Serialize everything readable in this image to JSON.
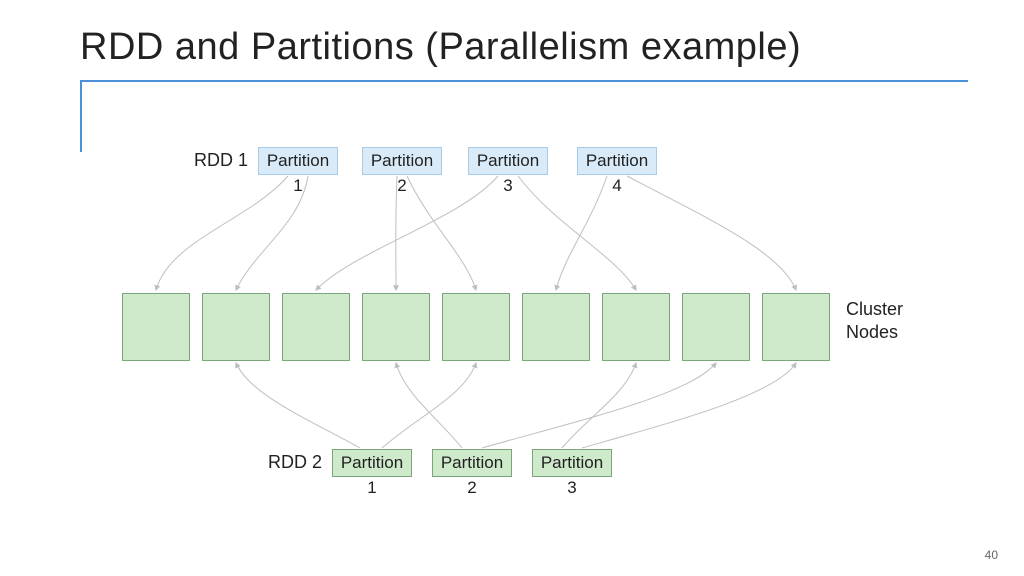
{
  "slide": {
    "title": "RDD and Partitions (Parallelism example)",
    "page_number": "40"
  },
  "rdd1": {
    "label": "RDD 1",
    "partitions": [
      {
        "name": "Partition",
        "num": "1"
      },
      {
        "name": "Partition",
        "num": "2"
      },
      {
        "name": "Partition",
        "num": "3"
      },
      {
        "name": "Partition",
        "num": "4"
      }
    ]
  },
  "cluster": {
    "label": "Cluster\nNodes",
    "count": 9
  },
  "rdd2": {
    "label": "RDD 2",
    "partitions": [
      {
        "name": "Partition",
        "num": "1"
      },
      {
        "name": "Partition",
        "num": "2"
      },
      {
        "name": "Partition",
        "num": "3"
      }
    ]
  }
}
